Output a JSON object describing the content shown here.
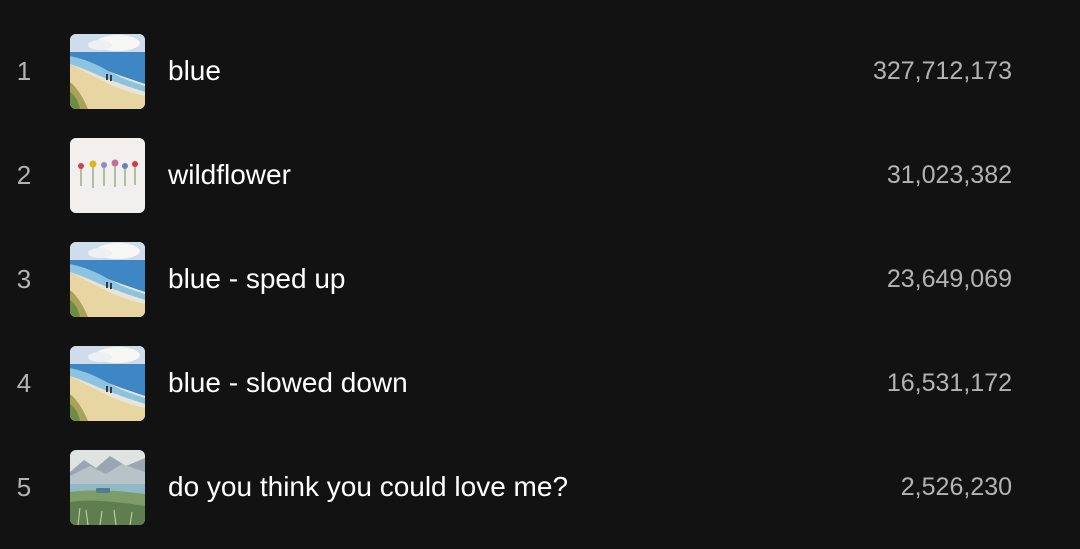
{
  "tracks": [
    {
      "number": "1",
      "title": "blue",
      "plays": "327,712,173",
      "cover": "beach-watercolor-cover"
    },
    {
      "number": "2",
      "title": "wildflower",
      "plays": "31,023,382",
      "cover": "wildflowers-cover"
    },
    {
      "number": "3",
      "title": "blue - sped up",
      "plays": "23,649,069",
      "cover": "beach-watercolor-cover"
    },
    {
      "number": "4",
      "title": "blue - slowed down",
      "plays": "16,531,172",
      "cover": "beach-watercolor-cover"
    },
    {
      "number": "5",
      "title": "do you think you could love me?",
      "plays": "2,526,230",
      "cover": "mountain-meadow-cover"
    }
  ]
}
